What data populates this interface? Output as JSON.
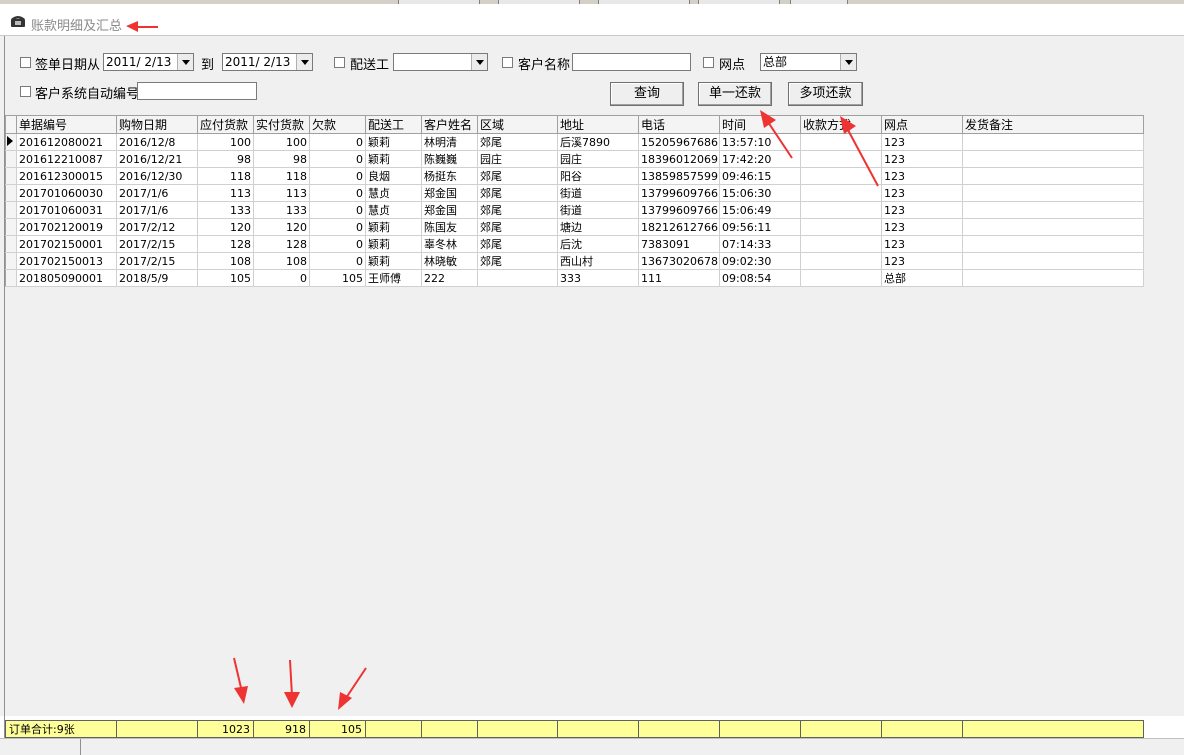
{
  "window": {
    "title": "账款明细及汇总",
    "accent_arrow_color": "#ee3333",
    "icon": "phone-icon"
  },
  "filters": {
    "sign_date_label": "签单日期从",
    "date_from": "2011/ 2/13",
    "to_label": "到",
    "date_to": "2011/ 2/13",
    "courier_label": "配送工",
    "courier_value": "",
    "customer_name_label": "客户名称",
    "customer_name_value": "",
    "branch_label": "网点",
    "branch_value": "总部",
    "customer_auto_no_label": "客户系统自动编号",
    "customer_auto_no_value": ""
  },
  "buttons": {
    "query": "查询",
    "single_repay": "单一还款",
    "multi_repay": "多项还款"
  },
  "table": {
    "columns": [
      "单据编号",
      "购物日期",
      "应付货款",
      "实付货款",
      "欠款",
      "配送工",
      "客户姓名",
      "区域",
      "地址",
      "电话",
      "时间",
      "收款方式",
      "网点",
      "发货备注"
    ],
    "rows": [
      [
        "201612080021",
        "2016/12/8",
        "100",
        "100",
        "0",
        "颖莉",
        "林明清",
        "郊尾",
        "后溪7890",
        "15205967686",
        "13:57:10",
        "",
        "123",
        ""
      ],
      [
        "201612210087",
        "2016/12/21",
        "98",
        "98",
        "0",
        "颖莉",
        "陈巍巍",
        "园庄",
        "园庄",
        "18396012069",
        "17:42:20",
        "",
        "123",
        ""
      ],
      [
        "201612300015",
        "2016/12/30",
        "118",
        "118",
        "0",
        "良烟",
        "杨挺东",
        "郊尾",
        "阳谷",
        "13859857599",
        "09:46:15",
        "",
        "123",
        ""
      ],
      [
        "201701060030",
        "2017/1/6",
        "113",
        "113",
        "0",
        "慧贞",
        "郑金国",
        "郊尾",
        "街道",
        "13799609766",
        "15:06:30",
        "",
        "123",
        ""
      ],
      [
        "201701060031",
        "2017/1/6",
        "133",
        "133",
        "0",
        "慧贞",
        "郑金国",
        "郊尾",
        "街道",
        "13799609766",
        "15:06:49",
        "",
        "123",
        ""
      ],
      [
        "201702120019",
        "2017/2/12",
        "120",
        "120",
        "0",
        "颖莉",
        "陈国友",
        "郊尾",
        "塘边",
        "18212612766",
        "09:56:11",
        "",
        "123",
        ""
      ],
      [
        "201702150001",
        "2017/2/15",
        "128",
        "128",
        "0",
        "颖莉",
        "辜冬林",
        "郊尾",
        "后沈",
        "7383091",
        "07:14:33",
        "",
        "123",
        ""
      ],
      [
        "201702150013",
        "2017/2/15",
        "108",
        "108",
        "0",
        "颖莉",
        "林晓敏",
        "郊尾",
        "西山村",
        "13673020678",
        "09:02:30",
        "",
        "123",
        ""
      ],
      [
        "201805090001",
        "2018/5/9",
        "105",
        "0",
        "105",
        "王师傅",
        "222",
        "",
        "333",
        "111",
        "09:08:54",
        "",
        "总部",
        ""
      ]
    ]
  },
  "footer": {
    "label": "订单合计:9张",
    "total_payable": "1023",
    "total_paid": "918",
    "total_owed": "105"
  }
}
